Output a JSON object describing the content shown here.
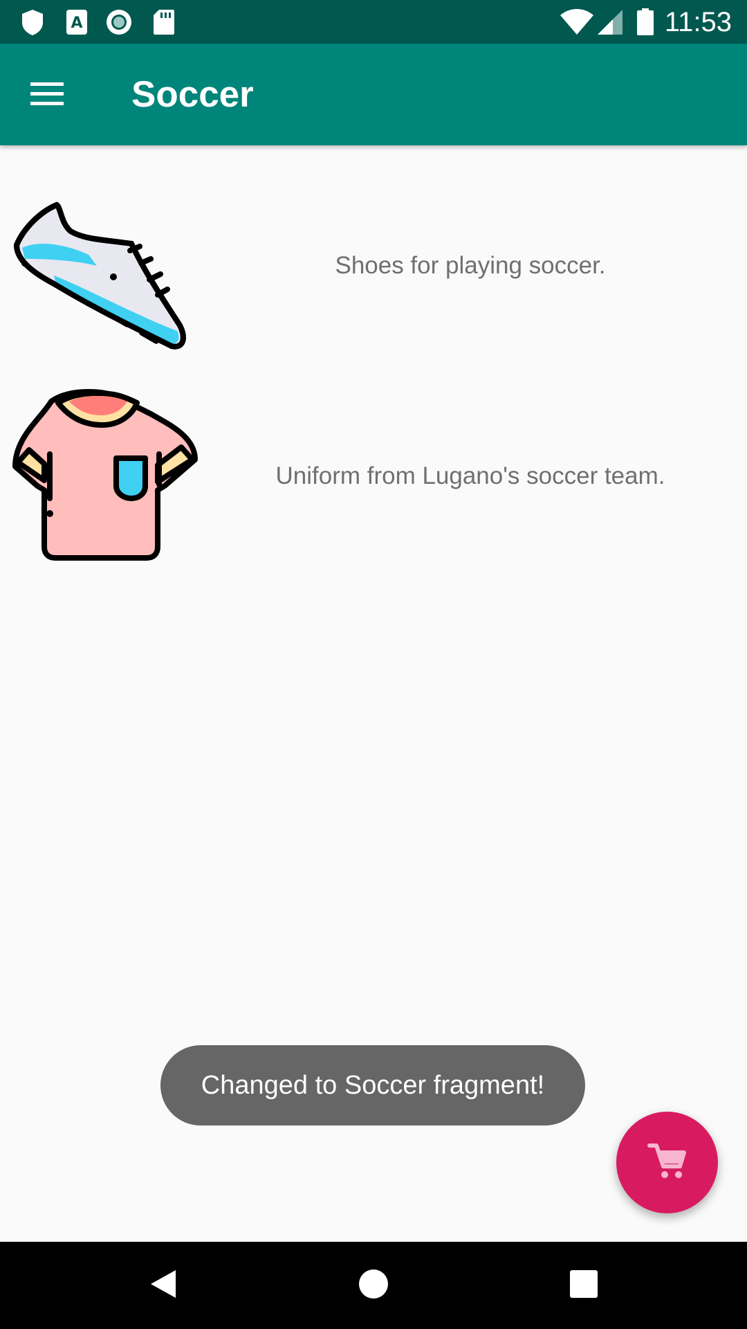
{
  "status_bar": {
    "time": "11:53",
    "icons": [
      "shield-icon",
      "a-notification-icon",
      "circle-notification-icon",
      "sd-card-icon",
      "wifi-icon",
      "signal-icon",
      "battery-icon"
    ]
  },
  "app_bar": {
    "title": "Soccer",
    "menu_icon": "hamburger-menu-icon"
  },
  "products": [
    {
      "description": "Shoes for playing soccer.",
      "icon": "soccer-shoe-icon"
    },
    {
      "description": "Uniform from Lugano's soccer team.",
      "icon": "soccer-shirt-icon"
    }
  ],
  "toast": {
    "message": "Changed to Soccer fragment!"
  },
  "fab": {
    "icon": "shopping-cart-icon",
    "color": "#d81b60"
  },
  "colors": {
    "status_bar": "#00584f",
    "app_bar": "#00857a",
    "background": "#fafafa",
    "accent": "#d81b60"
  },
  "nav_bar": {
    "icons": [
      "back-icon",
      "home-icon",
      "recents-icon"
    ]
  }
}
